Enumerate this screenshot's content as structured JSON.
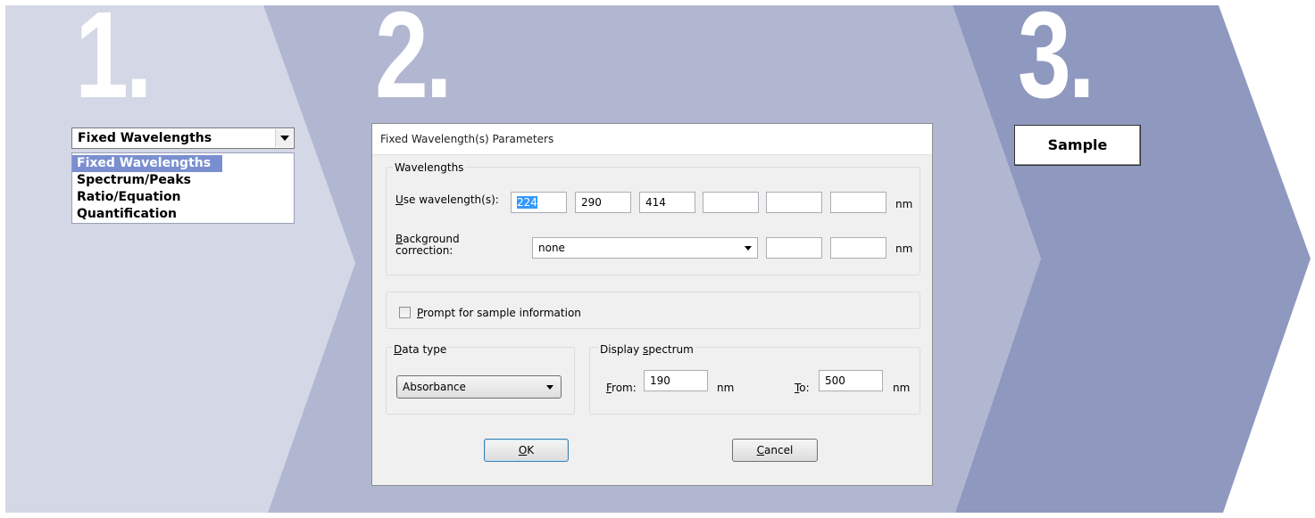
{
  "steps": {
    "one": "1.",
    "two": "2.",
    "three": "3."
  },
  "step1": {
    "combo_value": "Fixed Wavelengths",
    "options": [
      "Fixed Wavelengths",
      "Spectrum/Peaks",
      "Ratio/Equation",
      "Quantification"
    ],
    "selected_option": "Fixed Wavelengths"
  },
  "dialog": {
    "title": "Fixed Wavelength(s) Parameters",
    "wavelengths": {
      "group_label": "Wavelengths",
      "use_label_mnemonic": "U",
      "use_label_rest": "se wavelength(s):",
      "values": [
        "224",
        "290",
        "414",
        "",
        "",
        ""
      ],
      "unit": "nm",
      "background_mnemonic": "B",
      "background_rest": "ackground",
      "background_line2": "correction:",
      "background_value": "none",
      "background_fields": [
        "",
        ""
      ],
      "background_unit": "nm"
    },
    "prompt": {
      "mnemonic": "P",
      "rest": "rompt for sample information",
      "checked": false
    },
    "data_type": {
      "mnemonic": "D",
      "rest": "ata type",
      "value": "Absorbance"
    },
    "display_spectrum": {
      "label_pre": "Display ",
      "label_mnemonic": "s",
      "label_post": "pectrum",
      "from_mnemonic": "F",
      "from_rest": "rom:",
      "from_value": "190",
      "from_unit": "nm",
      "to_mnemonic": "T",
      "to_rest": "o:",
      "to_value": "500",
      "to_unit": "nm"
    },
    "ok_mnemonic": "O",
    "ok_rest": "K",
    "cancel_mnemonic": "C",
    "cancel_rest": "ancel"
  },
  "step3": {
    "sample_label": "Sample"
  },
  "colors": {
    "panel1": "#d3d7e6",
    "panel2": "#b1b7d1",
    "panel3": "#8f99bf"
  }
}
